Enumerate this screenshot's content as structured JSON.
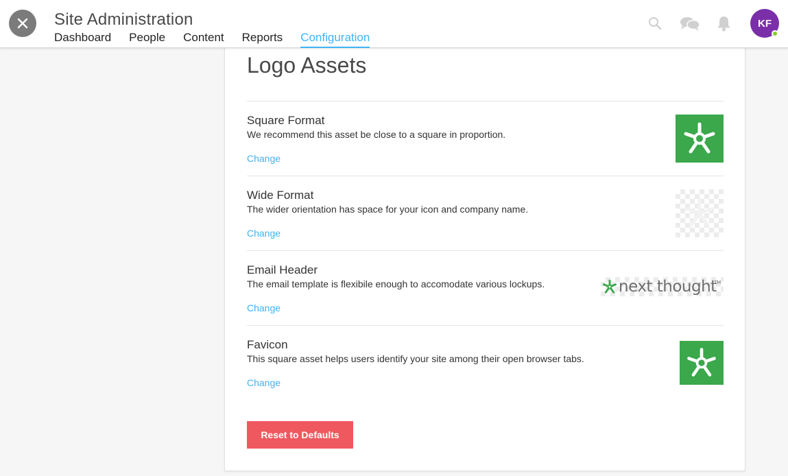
{
  "header": {
    "title": "Site Administration",
    "tabs": [
      {
        "label": "Dashboard"
      },
      {
        "label": "People"
      },
      {
        "label": "Content"
      },
      {
        "label": "Reports"
      },
      {
        "label": "Configuration"
      }
    ],
    "active_tab": "Configuration",
    "avatar_initials": "KF",
    "icons": [
      "close-icon",
      "search-icon",
      "chat-icon",
      "bell-icon"
    ]
  },
  "main": {
    "section_title": "Logo Assets",
    "assets": [
      {
        "name": "Square Format",
        "description": "We recommend this asset be close to a square in proportion.",
        "action": "Change"
      },
      {
        "name": "Wide Format",
        "description": "The wider orientation has space for your icon and company name.",
        "action": "Change"
      },
      {
        "name": "Email Header",
        "description": "The email template is flexibile enough to accomodate various lockups.",
        "action": "Change"
      },
      {
        "name": "Favicon",
        "description": "This square asset helps users identify your site among their open browser tabs.",
        "action": "Change"
      }
    ],
    "email_logo": {
      "wordmark": "next thought",
      "trademark": "TM"
    },
    "reset_label": "Reset to Defaults"
  },
  "colors": {
    "accent": "#3fb3f6",
    "brand_green": "#3aa84b",
    "reset_red": "#f0585f",
    "avatar_purple": "#7a2fa8",
    "presence_green": "#7ed321"
  }
}
